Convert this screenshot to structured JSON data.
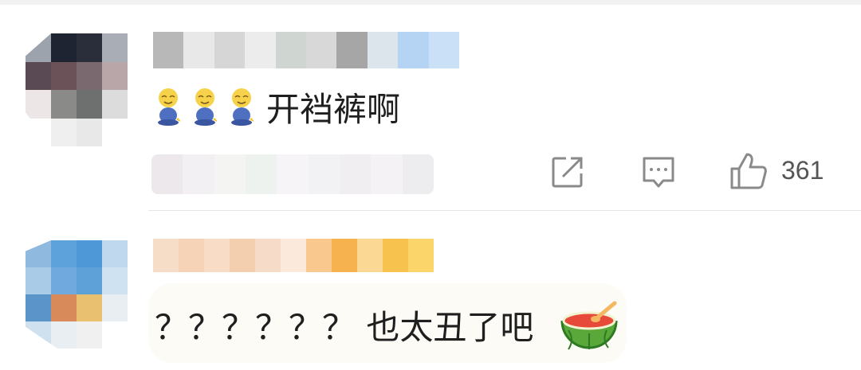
{
  "comments": [
    {
      "text": "开裆裤啊",
      "emoji": [
        "baby-sitting-emoji",
        "baby-sitting-emoji",
        "baby-sitting-emoji"
      ],
      "like_count": "361"
    },
    {
      "text": "？？？？？？ 也太丑了吧",
      "emoji_after": "watermelon-emoji"
    }
  ],
  "avatar1_colors": [
    "#9ca3ad",
    "#1f2433",
    "#2a2d3a",
    "#a9adb6",
    "#ffffff",
    "#5a4a54",
    "#6a5258",
    "#7a6a70",
    "#b8a6a8",
    "#ffffff",
    "#ece6e6",
    "#8a8a88",
    "#6e7070",
    "#dcdcdc",
    "#ffffff",
    "#ffffff",
    "#efefef",
    "#e8e8e8",
    "#ffffff",
    "#ffffff"
  ],
  "avatar2_colors": [
    "#8fb9de",
    "#5ea2dc",
    "#4f98d8",
    "#bfd8ee",
    "#ffffff",
    "#a9cbe8",
    "#6fa9dd",
    "#5ea0d8",
    "#cfe2f2",
    "#ffffff",
    "#5a94c8",
    "#d88a5a",
    "#e8c070",
    "#e9eef3",
    "#ffffff",
    "#cfe0ee",
    "#e8eef2",
    "#f0f0f0",
    "#ffffff",
    "#ffffff"
  ],
  "username1_colors": [
    "#b8b8b8",
    "#e8e8e8",
    "#d6d6d6",
    "#ececec",
    "#cfd6d2",
    "#d8d8d8",
    "#a6a6a6",
    "#dce4ec",
    "#b5d3f2",
    "#c9e0f6"
  ],
  "username2_colors": [
    "#f5ddc8",
    "#f6d2b6",
    "#f8dcc6",
    "#f3cfb0",
    "#f6dcc8",
    "#fbe9dc",
    "#f9c88e",
    "#f6b24e",
    "#fbd894",
    "#f8c24e",
    "#fbd56a"
  ],
  "meta1_colors": [
    "#ece8ec",
    "#f2f0f2",
    "#f4f4f2",
    "#eef2ee",
    "#f6f4f6",
    "#f2f2f4",
    "#f0eef0",
    "#f4f2f4",
    "#ededf0"
  ],
  "colors": {
    "icon": "#8a8a8a",
    "text": "#1f1f1f",
    "count": "#555555"
  }
}
